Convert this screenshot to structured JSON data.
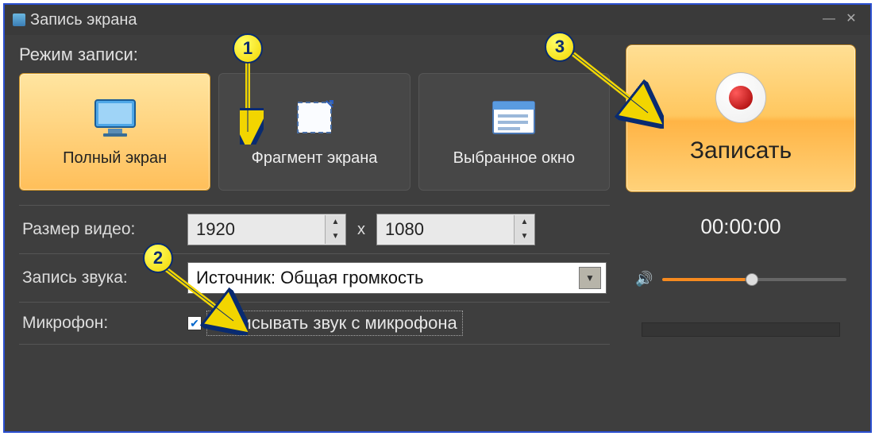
{
  "title": "Запись экрана",
  "modeLabel": "Режим записи:",
  "modes": {
    "full": "Полный экран",
    "fragment": "Фрагмент экрана",
    "window": "Выбранное окно"
  },
  "recordLabel": "Записать",
  "timer": "00:00:00",
  "videoSizeLabel": "Размер видео:",
  "width": "1920",
  "height": "1080",
  "xSymbol": "x",
  "audioLabel": "Запись звука:",
  "audioSource": "Источник: Общая громкость",
  "micLabel": "Микрофон:",
  "micCheckboxLabel": "Записывать звук с микрофона",
  "callouts": {
    "one": "1",
    "two": "2",
    "three": "3"
  },
  "icons": {
    "monitor": "monitor-icon",
    "crop": "crop-icon",
    "window": "window-icon",
    "speaker": "speaker-icon"
  },
  "colors": {
    "accent": "#f68a1f"
  }
}
